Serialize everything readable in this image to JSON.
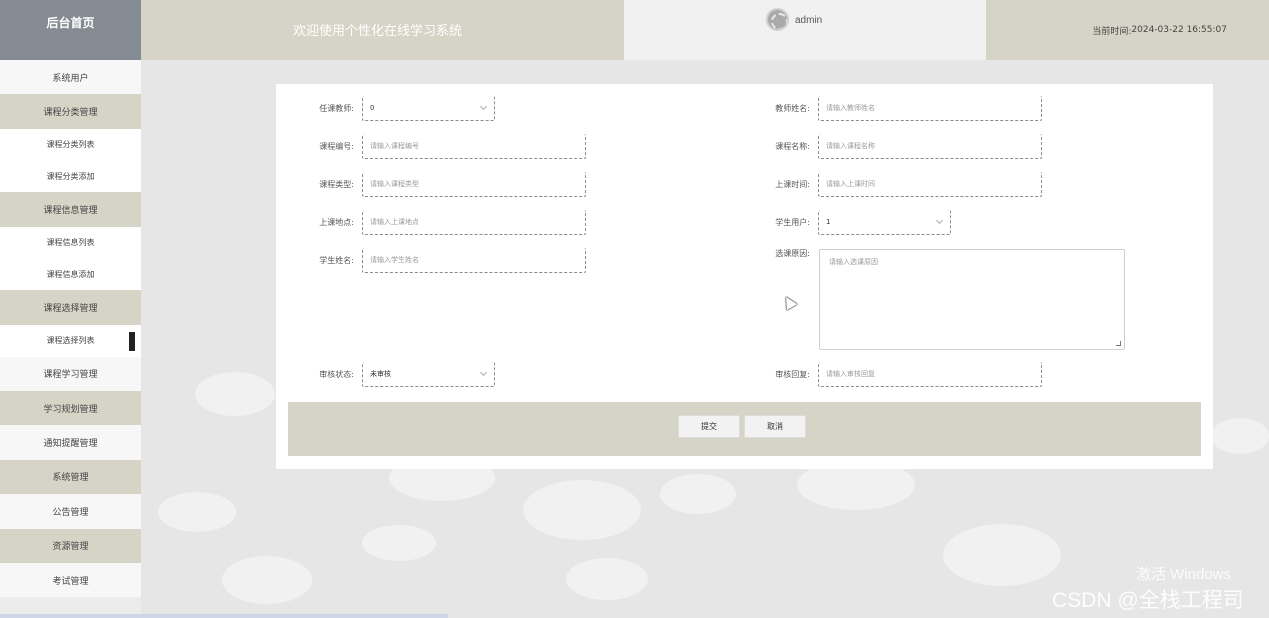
{
  "header": {
    "logo": "后台首页",
    "welcome": "欢迎使用个性化在线学习系统",
    "username": "admin",
    "time_label": "当前时间:",
    "time_value": "2024-03-22 16:55:07"
  },
  "sidebar": {
    "items": [
      {
        "label": "系统用户"
      },
      {
        "label": "课程分类管理"
      },
      {
        "label": "课程分类列表"
      },
      {
        "label": "课程分类添加"
      },
      {
        "label": "课程信息管理"
      },
      {
        "label": "课程信息列表"
      },
      {
        "label": "课程信息添加"
      },
      {
        "label": "课程选择管理"
      },
      {
        "label": "课程选择列表"
      },
      {
        "label": "课程学习管理"
      },
      {
        "label": "学习规划管理"
      },
      {
        "label": "通知提醒管理"
      },
      {
        "label": "系统管理"
      },
      {
        "label": "公告管理"
      },
      {
        "label": "资源管理"
      },
      {
        "label": "考试管理"
      }
    ]
  },
  "form": {
    "teacher_label": "任课教师:",
    "teacher_value": "0",
    "teacher_name_label": "教师姓名:",
    "teacher_name_placeholder": "请输入教师姓名",
    "course_no_label": "课程编号:",
    "course_no_placeholder": "请输入课程编号",
    "course_name_label": "课程名称:",
    "course_name_placeholder": "请输入课程名称",
    "course_type_label": "课程类型:",
    "course_type_placeholder": "请输入课程类型",
    "class_time_label": "上课时间:",
    "class_time_placeholder": "请输入上课时间",
    "class_place_label": "上课地点:",
    "class_place_placeholder": "请输入上课地点",
    "student_user_label": "学生用户:",
    "student_user_value": "1",
    "student_name_label": "学生姓名:",
    "student_name_placeholder": "请输入学生姓名",
    "reason_label": "选课原因:",
    "reason_placeholder": "请输入选课原因",
    "audit_status_label": "审核状态:",
    "audit_status_value": "未审核",
    "audit_reply_label": "审核回复:",
    "audit_reply_placeholder": "请输入审核回复",
    "submit": "提交",
    "cancel": "取消"
  },
  "watermark": {
    "windows": "激活 Windows",
    "csdn": "CSDN @全栈工程司"
  }
}
